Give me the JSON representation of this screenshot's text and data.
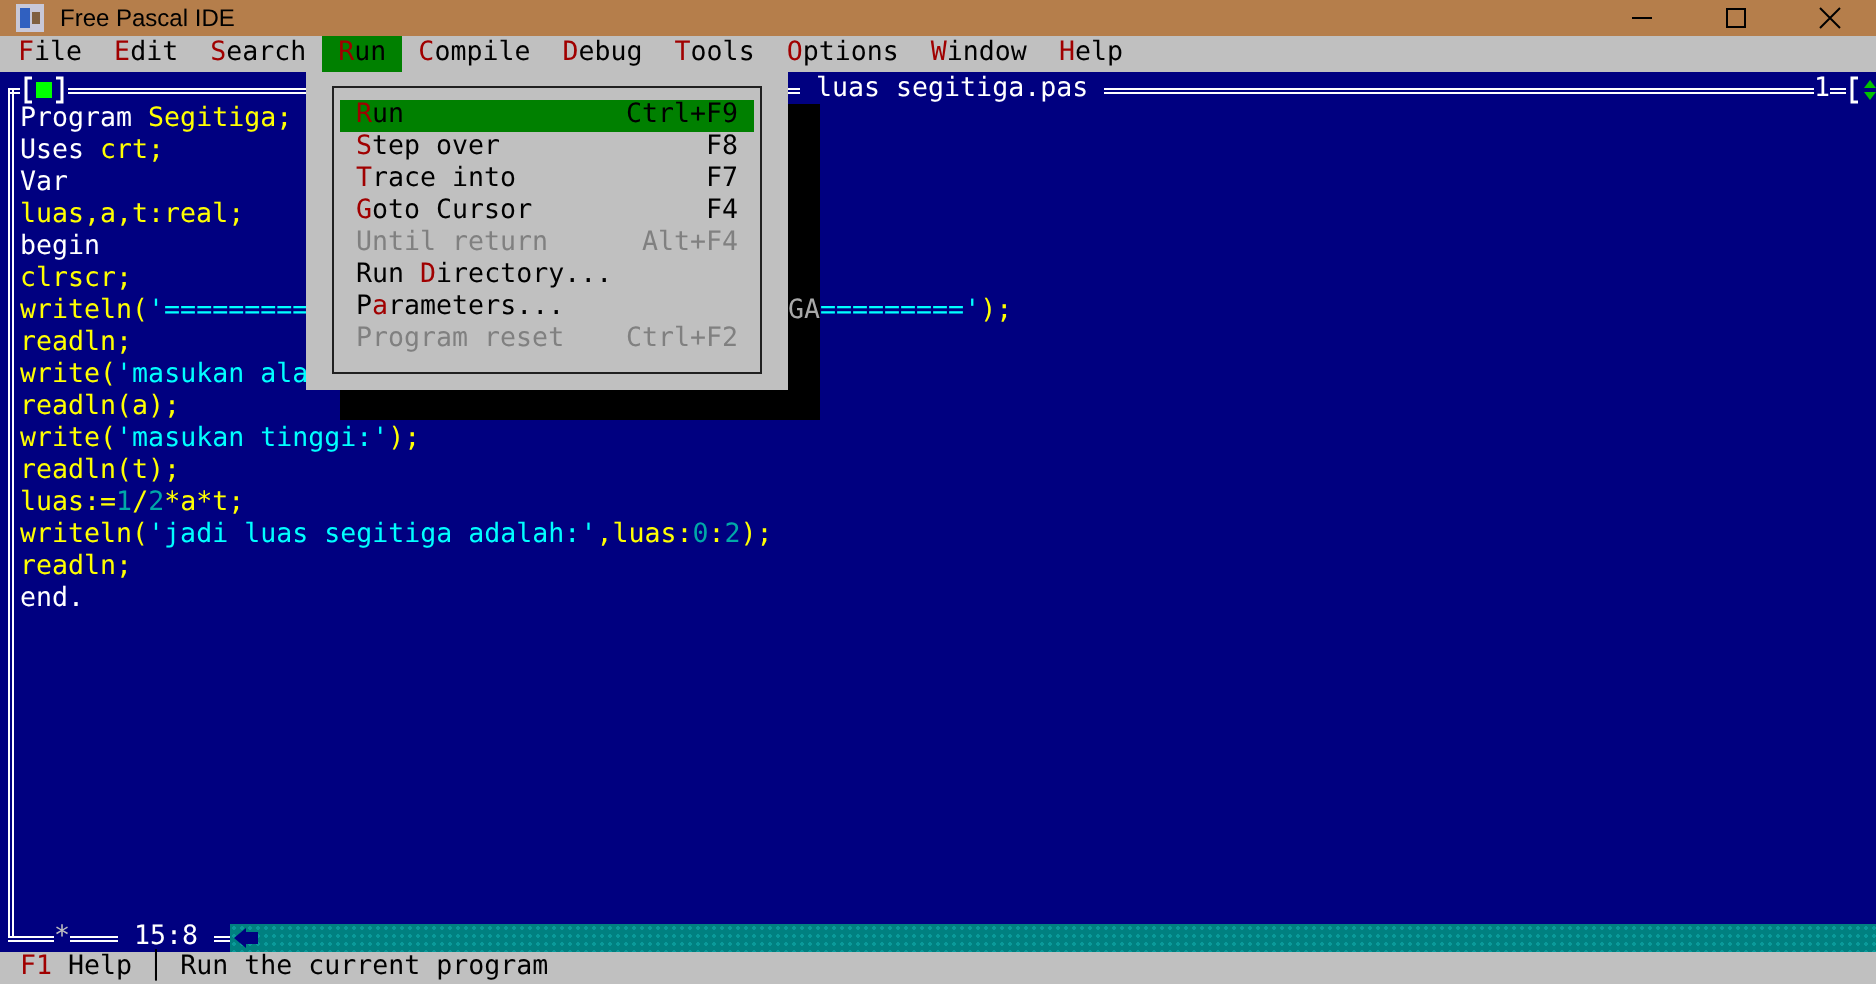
{
  "window": {
    "title": "Free Pascal IDE"
  },
  "menu_bar": [
    {
      "hotkey": "F",
      "rest": "ile",
      "selected": false
    },
    {
      "hotkey": "E",
      "rest": "dit",
      "selected": false
    },
    {
      "hotkey": "S",
      "rest": "earch",
      "selected": false
    },
    {
      "hotkey": "R",
      "rest": "un",
      "selected": true
    },
    {
      "hotkey": "C",
      "rest": "ompile",
      "selected": false
    },
    {
      "hotkey": "D",
      "rest": "ebug",
      "selected": false
    },
    {
      "hotkey": "T",
      "rest": "ools",
      "selected": false
    },
    {
      "hotkey": "O",
      "rest": "ptions",
      "selected": false
    },
    {
      "hotkey": "W",
      "rest": "indow",
      "selected": false
    },
    {
      "hotkey": "H",
      "rest": "elp",
      "selected": false
    }
  ],
  "run_menu": [
    {
      "hotkey": "R",
      "after": "un",
      "shortcut": "Ctrl+F9",
      "selected": true,
      "disabled": false
    },
    {
      "hotkey": "S",
      "after": "tep over",
      "shortcut": "F8",
      "selected": false,
      "disabled": false
    },
    {
      "hotkey": "T",
      "after": "race into",
      "shortcut": "F7",
      "selected": false,
      "disabled": false
    },
    {
      "hotkey": "G",
      "after": "oto Cursor",
      "shortcut": "F4",
      "selected": false,
      "disabled": false
    },
    {
      "label": "Until return",
      "shortcut": "Alt+F4",
      "selected": false,
      "disabled": true
    },
    {
      "before": "Run ",
      "hotkey": "D",
      "after": "irectory...",
      "selected": false,
      "disabled": false
    },
    {
      "before": "P",
      "hotkey": "a",
      "after": "rameters...",
      "selected": false,
      "disabled": false
    },
    {
      "label": "Program reset",
      "shortcut": "Ctrl+F2",
      "selected": false,
      "disabled": true
    }
  ],
  "editor": {
    "title": "luas segitiga.pas",
    "window_number": "1",
    "modified_mark": "*",
    "cursor_position": "15:8",
    "lines": [
      {
        "tokens": [
          {
            "kind": "reserved",
            "text": "Program "
          },
          {
            "kind": "ident",
            "text": "Segitiga;"
          }
        ]
      },
      {
        "tokens": [
          {
            "kind": "reserved",
            "text": "Uses "
          },
          {
            "kind": "ident",
            "text": "crt;"
          }
        ]
      },
      {
        "tokens": [
          {
            "kind": "reserved",
            "text": "Var"
          }
        ]
      },
      {
        "tokens": [
          {
            "kind": "ident",
            "text": "luas,a,t:real;"
          }
        ]
      },
      {
        "tokens": [
          {
            "kind": "reserved",
            "text": "begin"
          }
        ]
      },
      {
        "tokens": [
          {
            "kind": "ident",
            "text": "clrscr;"
          }
        ]
      },
      {
        "tokens": [
          {
            "kind": "ident",
            "text": "writeln("
          },
          {
            "kind": "string",
            "text": "'========="
          }
        ],
        "after_menu": [
          {
            "kind": "shadowed",
            "text": "GA"
          },
          {
            "kind": "string",
            "text": "========='"
          },
          {
            "kind": "ident",
            "text": ");"
          }
        ]
      },
      {
        "tokens": [
          {
            "kind": "ident",
            "text": "readln;"
          }
        ]
      },
      {
        "tokens": [
          {
            "kind": "ident",
            "text": "write("
          },
          {
            "kind": "string",
            "text": "'masukan ala"
          }
        ]
      },
      {
        "tokens": [
          {
            "kind": "ident",
            "text": "readln(a);"
          }
        ]
      },
      {
        "tokens": [
          {
            "kind": "ident",
            "text": "write("
          },
          {
            "kind": "string",
            "text": "'masukan tinggi:'"
          },
          {
            "kind": "ident",
            "text": ");"
          }
        ]
      },
      {
        "tokens": [
          {
            "kind": "ident",
            "text": "readln(t);"
          }
        ]
      },
      {
        "tokens": [
          {
            "kind": "ident",
            "text": "luas:="
          },
          {
            "kind": "number",
            "text": "1"
          },
          {
            "kind": "ident",
            "text": "/"
          },
          {
            "kind": "number",
            "text": "2"
          },
          {
            "kind": "ident",
            "text": "*a*t;"
          }
        ]
      },
      {
        "tokens": [
          {
            "kind": "ident",
            "text": "writeln("
          },
          {
            "kind": "string",
            "text": "'jadi luas segitiga adalah:'"
          },
          {
            "kind": "ident",
            "text": ",luas:"
          },
          {
            "kind": "number",
            "text": "0"
          },
          {
            "kind": "ident",
            "text": ":"
          },
          {
            "kind": "number",
            "text": "2"
          },
          {
            "kind": "ident",
            "text": ");"
          }
        ]
      },
      {
        "tokens": [
          {
            "kind": "ident",
            "text": "readln;"
          }
        ]
      },
      {
        "tokens": [
          {
            "kind": "reserved",
            "text": "end."
          }
        ]
      }
    ]
  },
  "status_bar": {
    "key": "F1",
    "key_label": " Help",
    "separator": "│",
    "hint": "Run the current program"
  }
}
